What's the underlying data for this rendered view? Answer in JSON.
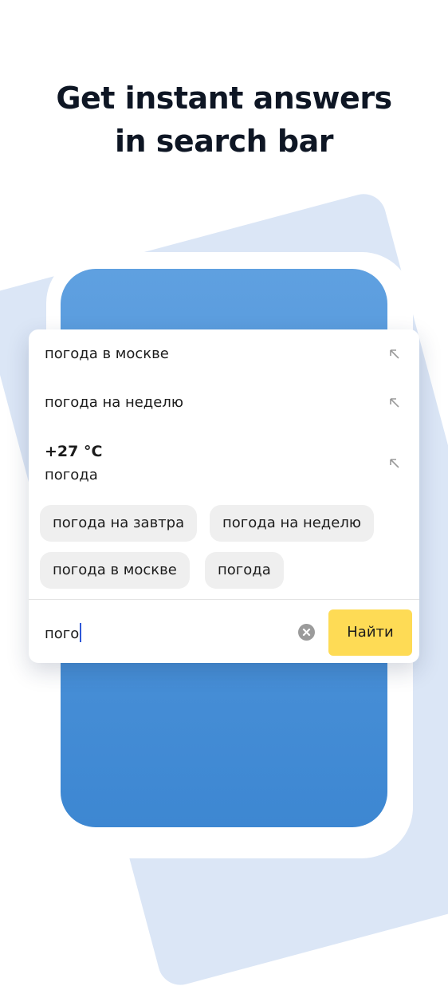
{
  "headline": {
    "line1": "Get instant answers",
    "line2": "in search bar"
  },
  "suggestions": [
    {
      "text": "погода в москве",
      "icon": "arrow-up-left-icon"
    },
    {
      "text": "погода на неделю",
      "icon": "arrow-up-left-icon"
    }
  ],
  "weather": {
    "temperature": "+27 °C",
    "label": "погода",
    "icon": "arrow-up-left-icon"
  },
  "chips": [
    "погода на завтра",
    "погода на неделю",
    "погода в москве",
    "погода"
  ],
  "search": {
    "query": "пого",
    "clear_icon": "clear-icon",
    "find_label": "Найти"
  },
  "colors": {
    "headline": "#0e1624",
    "background_card": "#dbe6f6",
    "screen_top": "#5fa0e0",
    "screen_bottom": "#3d87d2",
    "chip_bg": "#efefef",
    "find_button": "#fedb55",
    "caret": "#2f58d8"
  }
}
